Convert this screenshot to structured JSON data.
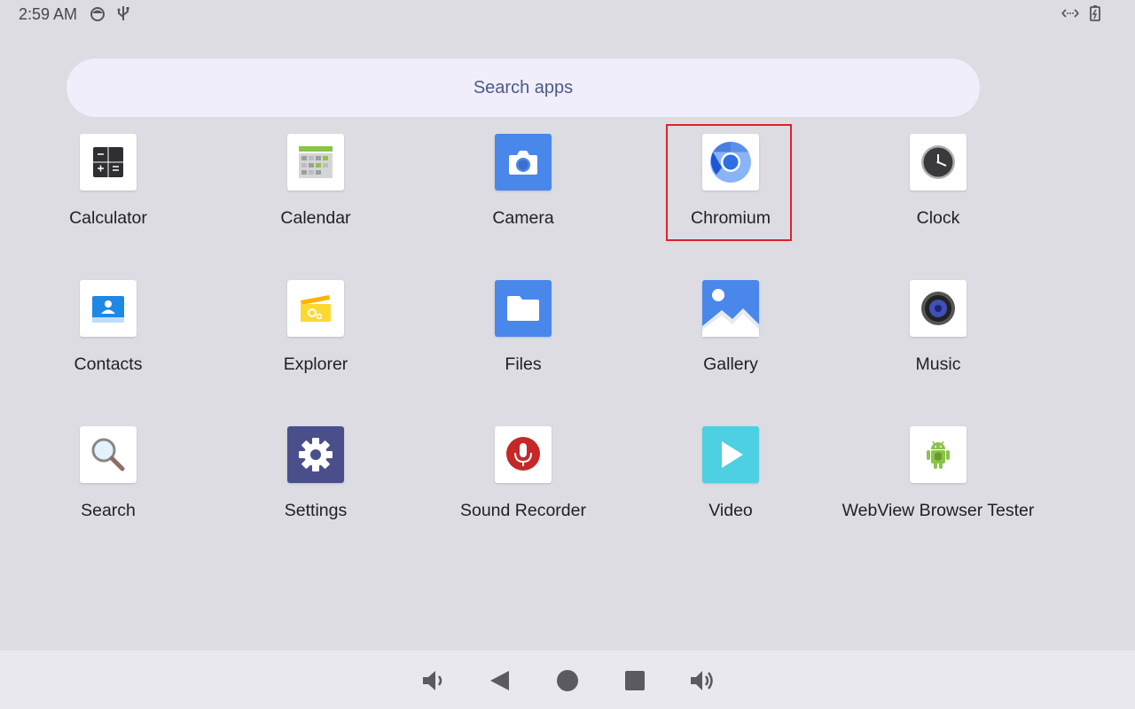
{
  "status_bar": {
    "time": "2:59 AM",
    "left_icons": [
      "android-face-icon",
      "usb-icon"
    ],
    "right_icons": [
      "data-transfer-icon",
      "battery-charging-icon"
    ]
  },
  "search": {
    "placeholder": "Search apps"
  },
  "apps": [
    {
      "label": "Calculator",
      "icon": "calculator-icon"
    },
    {
      "label": "Calendar",
      "icon": "calendar-icon"
    },
    {
      "label": "Camera",
      "icon": "camera-icon"
    },
    {
      "label": "Chromium",
      "icon": "chromium-icon",
      "highlighted": true
    },
    {
      "label": "Clock",
      "icon": "clock-icon"
    },
    {
      "label": "Contacts",
      "icon": "contacts-icon"
    },
    {
      "label": "Explorer",
      "icon": "explorer-icon"
    },
    {
      "label": "Files",
      "icon": "files-icon"
    },
    {
      "label": "Gallery",
      "icon": "gallery-icon"
    },
    {
      "label": "Music",
      "icon": "music-icon"
    },
    {
      "label": "Search",
      "icon": "magnifier-icon"
    },
    {
      "label": "Settings",
      "icon": "settings-gear-icon"
    },
    {
      "label": "Sound Recorder",
      "icon": "microphone-icon"
    },
    {
      "label": "Video",
      "icon": "play-icon"
    },
    {
      "label": "WebView Browser Tester",
      "icon": "android-robot-icon"
    }
  ],
  "nav_bar": {
    "buttons": [
      "volume-down-icon",
      "back-icon",
      "home-icon",
      "recents-icon",
      "volume-up-icon"
    ]
  },
  "colors": {
    "background": "#dddce3",
    "search_bg": "#efeefa",
    "search_text": "#4d5a8a",
    "highlight": "#e0202b",
    "nav_bg": "#e8e8ee"
  }
}
